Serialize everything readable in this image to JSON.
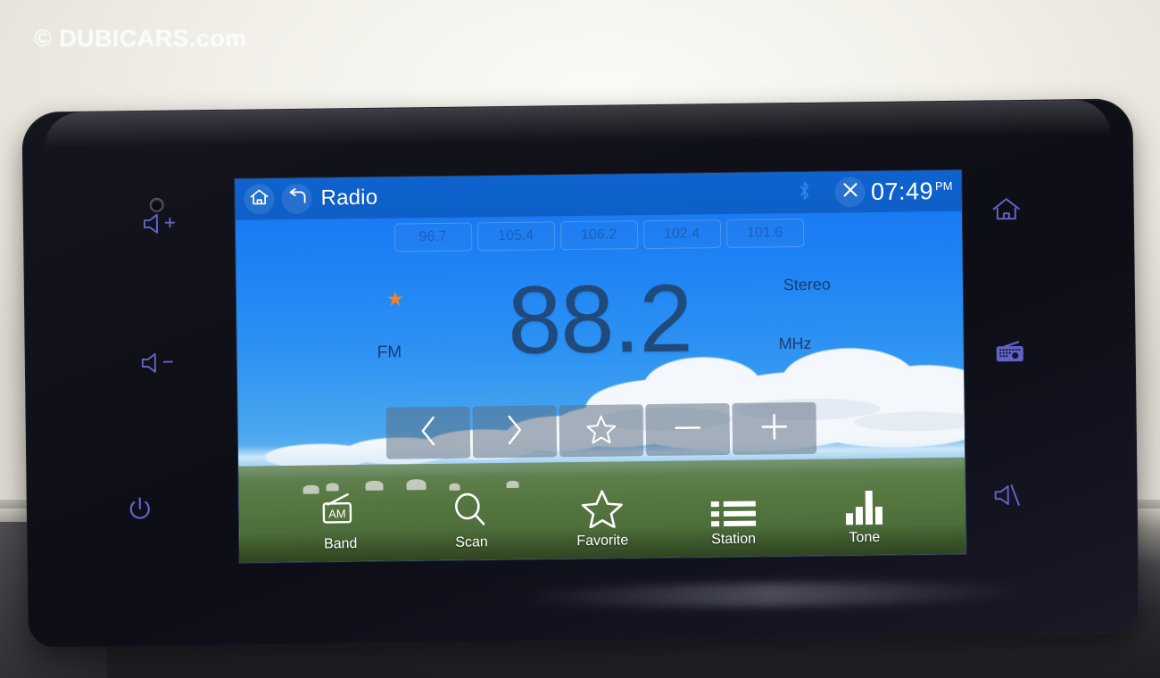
{
  "watermark": {
    "text": "© DUBICARS.com"
  },
  "titlebar": {
    "home_icon": "home-icon",
    "back_icon": "back-arrow-icon",
    "title": "Radio",
    "bluetooth_icon": "bluetooth-icon",
    "close_icon": "close-icon",
    "time": "07:49",
    "ampm": "PM"
  },
  "presets": [
    {
      "label": "96.7"
    },
    {
      "label": "105.4"
    },
    {
      "label": "106.2"
    },
    {
      "label": "102.4"
    },
    {
      "label": "101.6"
    }
  ],
  "tuner": {
    "favorite_star": "★",
    "band": "FM",
    "frequency": "88.2",
    "unit": "MHz",
    "stereo": "Stereo"
  },
  "controls": [
    {
      "name": "seek-prev-button",
      "glyph": "‹",
      "icon": "chevron-left-icon"
    },
    {
      "name": "seek-next-button",
      "glyph": "›",
      "icon": "chevron-right-icon"
    },
    {
      "name": "favorite-button",
      "glyph": "☆",
      "icon": "star-outline-icon"
    },
    {
      "name": "tune-down-button",
      "glyph": "−",
      "icon": "minus-icon"
    },
    {
      "name": "tune-up-button",
      "glyph": "+",
      "icon": "plus-icon"
    }
  ],
  "toolbar": [
    {
      "label": "Band",
      "icon": "radio-am-icon",
      "badge": "AM"
    },
    {
      "label": "Scan",
      "icon": "search-icon"
    },
    {
      "label": "Favorite",
      "icon": "star-outline-icon"
    },
    {
      "label": "Station",
      "icon": "list-icon"
    },
    {
      "label": "Tone",
      "icon": "equalizer-icon"
    }
  ],
  "hardware_keys": [
    {
      "name": "volume-up-key",
      "icon": "volume-up-icon"
    },
    {
      "name": "volume-down-key",
      "icon": "volume-down-icon"
    },
    {
      "name": "power-key",
      "icon": "power-icon"
    },
    {
      "name": "home-key",
      "icon": "home-icon"
    },
    {
      "name": "radio-key",
      "icon": "radio-icon"
    },
    {
      "name": "mute-key",
      "icon": "mute-icon"
    }
  ],
  "colors": {
    "titlebar": "#0e5fc7",
    "screen_blue": "#1d82f5",
    "frequency_text": "#214a7c",
    "favorite_star": "#f58220",
    "key_purple": "#6b6bd4"
  }
}
